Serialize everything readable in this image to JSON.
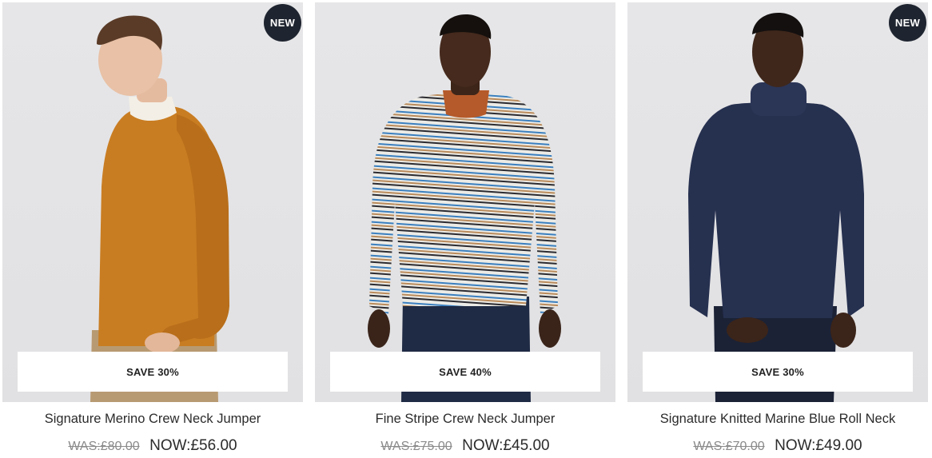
{
  "products": [
    {
      "badge": "NEW",
      "save_label": "SAVE 30%",
      "title": "Signature Merino Crew Neck Jumper",
      "was_price": "WAS:£80.00",
      "now_price": "NOW:£56.00",
      "sweater_color": "#c97d22"
    },
    {
      "badge": "",
      "save_label": "SAVE 40%",
      "title": "Fine Stripe Crew Neck Jumper",
      "was_price": "WAS:£75.00",
      "now_price": "NOW:£45.00",
      "sweater_color": "#ecebe6"
    },
    {
      "badge": "NEW",
      "save_label": "SAVE 30%",
      "title": "Signature Knitted Marine Blue Roll Neck",
      "was_price": "WAS:£70.00",
      "now_price": "NOW:£49.00",
      "sweater_color": "#26304f"
    }
  ]
}
